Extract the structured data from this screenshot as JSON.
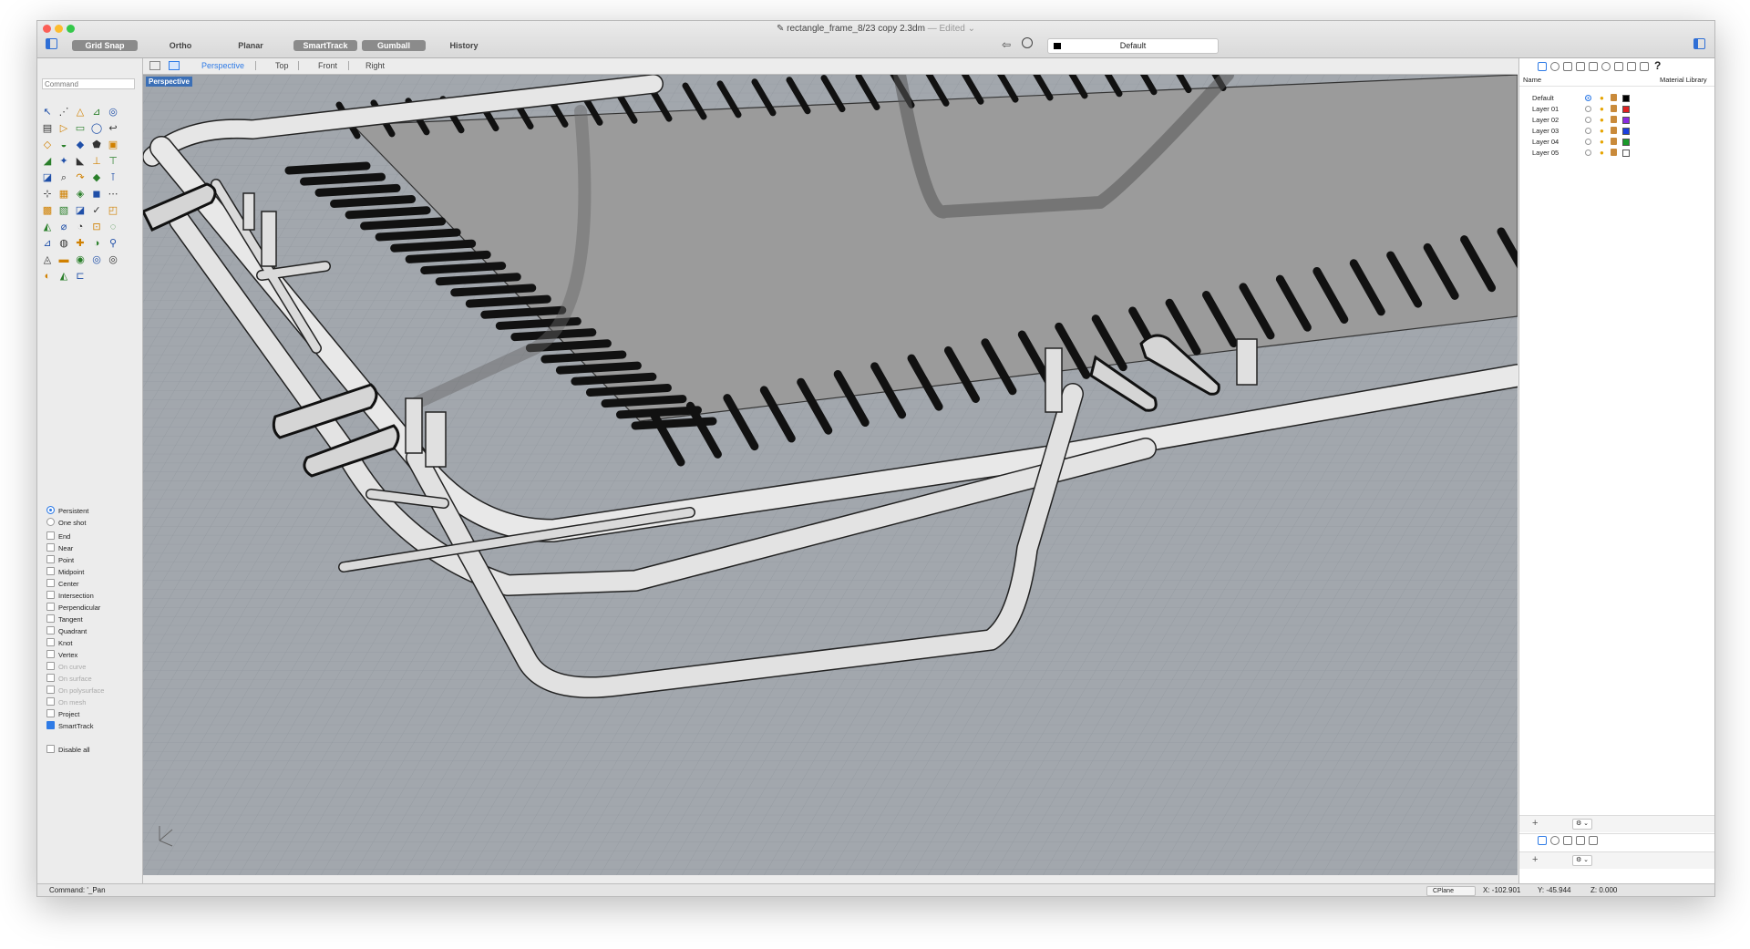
{
  "window": {
    "title": "rectangle_frame_8/23 copy 2.3dm",
    "edited": "— Edited ⌄",
    "traffic_lights": [
      "#fc5f57",
      "#fdbc2e",
      "#34c84a"
    ]
  },
  "toolbar": {
    "grid_snap": "Grid Snap",
    "ortho": "Ortho",
    "planar": "Planar",
    "smart_track": "SmartTrack",
    "gumball": "Gumball",
    "history": "History",
    "current_layer": "Default",
    "current_layer_color": "#000000"
  },
  "command": {
    "placeholder": "Command"
  },
  "osnap": {
    "persistent": "Persistent",
    "one_shot": "One shot",
    "items": [
      {
        "label": "End",
        "checked": false,
        "enabled": true
      },
      {
        "label": "Near",
        "checked": false,
        "enabled": true
      },
      {
        "label": "Point",
        "checked": false,
        "enabled": true
      },
      {
        "label": "Midpoint",
        "checked": false,
        "enabled": true
      },
      {
        "label": "Center",
        "checked": false,
        "enabled": true
      },
      {
        "label": "Intersection",
        "checked": false,
        "enabled": true
      },
      {
        "label": "Perpendicular",
        "checked": false,
        "enabled": true
      },
      {
        "label": "Tangent",
        "checked": false,
        "enabled": true
      },
      {
        "label": "Quadrant",
        "checked": false,
        "enabled": true
      },
      {
        "label": "Knot",
        "checked": false,
        "enabled": true
      },
      {
        "label": "Vertex",
        "checked": false,
        "enabled": true
      },
      {
        "label": "On curve",
        "checked": false,
        "enabled": false
      },
      {
        "label": "On surface",
        "checked": false,
        "enabled": false
      },
      {
        "label": "On polysurface",
        "checked": false,
        "enabled": false
      },
      {
        "label": "On mesh",
        "checked": false,
        "enabled": false
      },
      {
        "label": "Project",
        "checked": false,
        "enabled": true
      },
      {
        "label": "SmartTrack",
        "checked": true,
        "enabled": true
      }
    ],
    "disable_all": "Disable all"
  },
  "viewport": {
    "tabs": [
      "Perspective",
      "Top",
      "Front",
      "Right"
    ],
    "active_tab": "Perspective",
    "label": "Perspective"
  },
  "layers": {
    "header_name": "Name",
    "header_material": "Material Library",
    "rows": [
      {
        "name": "Default",
        "current": true,
        "color": "#000000"
      },
      {
        "name": "Layer 01",
        "current": false,
        "color": "#e02020"
      },
      {
        "name": "Layer 02",
        "current": false,
        "color": "#8a2be2"
      },
      {
        "name": "Layer 03",
        "current": false,
        "color": "#1a3fe0"
      },
      {
        "name": "Layer 04",
        "current": false,
        "color": "#1a9a2a"
      },
      {
        "name": "Layer 05",
        "current": false,
        "color": "#ffffff"
      }
    ],
    "add": "+",
    "gear": "⚙ ⌄"
  },
  "status": {
    "command": "Command: '_Pan",
    "cplane": "CPlane",
    "x": "X: -102.901",
    "y": "Y: -45.944",
    "z": "Z: 0.000"
  }
}
